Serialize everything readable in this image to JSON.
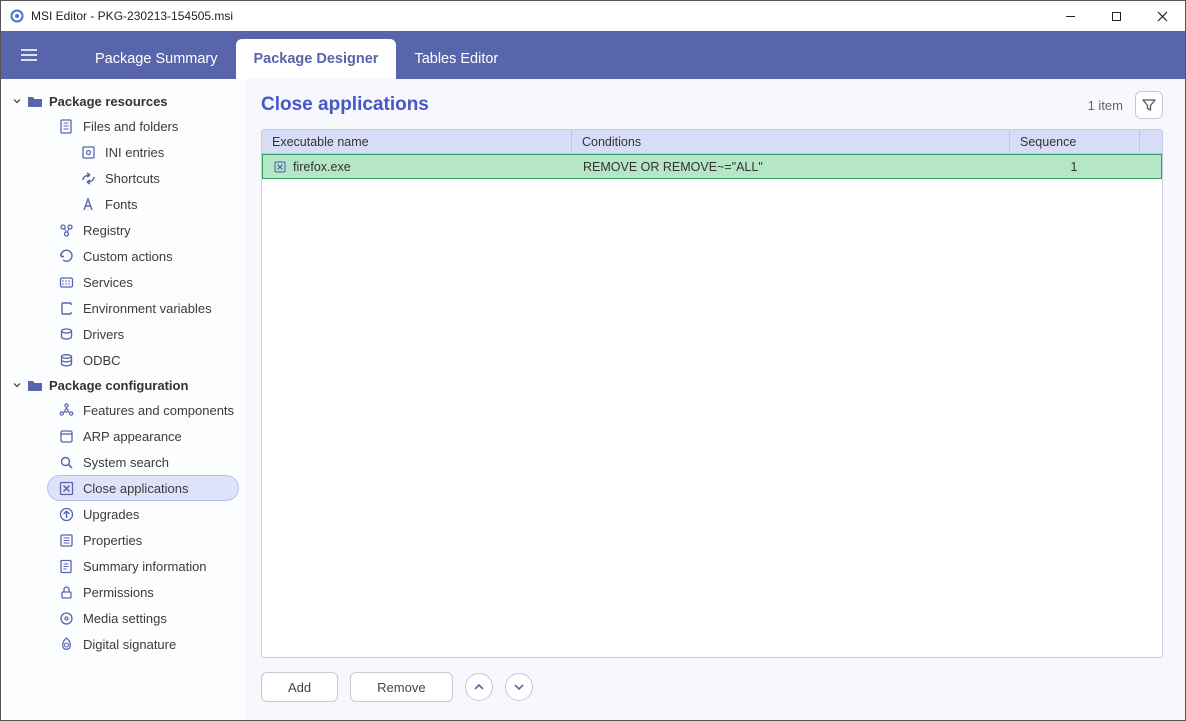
{
  "window": {
    "title": "MSI Editor - PKG-230213-154505.msi"
  },
  "nav": {
    "items": [
      {
        "label": "Package Summary",
        "active": false
      },
      {
        "label": "Package Designer",
        "active": true
      },
      {
        "label": "Tables Editor",
        "active": false
      }
    ]
  },
  "sidebar": {
    "groups": [
      {
        "label": "Package resources",
        "items": [
          {
            "label": "Files and folders",
            "icon": "file-icon",
            "depth": 1
          },
          {
            "label": "INI entries",
            "icon": "ini-icon",
            "depth": 2
          },
          {
            "label": "Shortcuts",
            "icon": "shortcut-icon",
            "depth": 2
          },
          {
            "label": "Fonts",
            "icon": "font-icon",
            "depth": 2
          },
          {
            "label": "Registry",
            "icon": "registry-icon",
            "depth": 1
          },
          {
            "label": "Custom actions",
            "icon": "action-icon",
            "depth": 1
          },
          {
            "label": "Services",
            "icon": "services-icon",
            "depth": 1
          },
          {
            "label": "Environment variables",
            "icon": "env-icon",
            "depth": 1
          },
          {
            "label": "Drivers",
            "icon": "drivers-icon",
            "depth": 1
          },
          {
            "label": "ODBC",
            "icon": "odbc-icon",
            "depth": 1
          }
        ]
      },
      {
        "label": "Package configuration",
        "items": [
          {
            "label": "Features and components",
            "icon": "features-icon",
            "depth": 1
          },
          {
            "label": "ARP appearance",
            "icon": "arp-icon",
            "depth": 1
          },
          {
            "label": "System search",
            "icon": "search-icon",
            "depth": 1
          },
          {
            "label": "Close applications",
            "icon": "close-app-icon",
            "depth": 1,
            "selected": true
          },
          {
            "label": "Upgrades",
            "icon": "upgrades-icon",
            "depth": 1
          },
          {
            "label": "Properties",
            "icon": "properties-icon",
            "depth": 1
          },
          {
            "label": "Summary information",
            "icon": "summary-icon",
            "depth": 1
          },
          {
            "label": "Permissions",
            "icon": "permissions-icon",
            "depth": 1
          },
          {
            "label": "Media settings",
            "icon": "media-icon",
            "depth": 1
          },
          {
            "label": "Digital signature",
            "icon": "signature-icon",
            "depth": 1
          }
        ]
      }
    ]
  },
  "page": {
    "title": "Close applications",
    "count_label": "1 item"
  },
  "table": {
    "headers": {
      "exec": "Executable name",
      "cond": "Conditions",
      "seq": "Sequence"
    },
    "rows": [
      {
        "exec": "firefox.exe",
        "cond": "REMOVE OR REMOVE~=\"ALL\"",
        "seq": "1",
        "selected": true
      }
    ]
  },
  "footer": {
    "add": "Add",
    "remove": "Remove"
  },
  "icons": {
    "file-icon": "<rect x='3' y='2' width='10' height='13' rx='1' fill='none' stroke='currentColor' stroke-width='1.3'/><line x1='5.5' y1='5' x2='10.5' y2='5' stroke='currentColor'/><line x1='5.5' y1='8' x2='10.5' y2='8' stroke='currentColor'/><line x1='5.5' y1='11' x2='10.5' y2='11' stroke='currentColor'/>",
    "ini-icon": "<rect x='3' y='3' width='11' height='11' rx='1' fill='none' stroke='currentColor' stroke-width='1.3'/><circle cx='8.5' cy='8.5' r='2' fill='none' stroke='currentColor' stroke-width='1.2'/>",
    "shortcut-icon": "<path d='M3 10 C 3 5, 10 5, 10 5 M10 5 L7 3 M10 5 L7 7' fill='none' stroke='currentColor' stroke-width='1.4'/><path d='M14 7 C 14 12, 7 12, 7 12 M7 12 L10 14 M7 12 L10 10' fill='none' stroke='currentColor' stroke-width='1.4'/>",
    "font-icon": "<path d='M4 14 L8 3 L12 14 M5.5 10 H10.5' fill='none' stroke='currentColor' stroke-width='1.4'/>",
    "registry-icon": "<circle cx='5' cy='5' r='2' fill='none' stroke='currentColor' stroke-width='1.3'/><circle cx='12' cy='5' r='2' fill='none' stroke='currentColor' stroke-width='1.3'/><circle cx='8.5' cy='12' r='2' fill='none' stroke='currentColor' stroke-width='1.3'/><line x1='6.5' y1='6.5' x2='8' y2='10' stroke='currentColor'/><line x1='11' y1='6.5' x2='9.5' y2='10' stroke='currentColor'/>",
    "action-icon": "<path d='M3 8.5 A5.5 5.5 0 1 1 5 12' fill='none' stroke='currentColor' stroke-width='1.4'/><path d='M3 8.5 L3 5 M3 8.5 L6 8.5' fill='none' stroke='currentColor' stroke-width='1.4'/>",
    "services-icon": "<rect x='2.5' y='4' width='12' height='9' rx='1.5' fill='none' stroke='currentColor' stroke-width='1.3'/><circle cx='5' cy='7' r='0.8' fill='currentColor'/><circle cx='8' cy='7' r='0.8' fill='currentColor'/><circle cx='11' cy='7' r='0.8' fill='currentColor'/><circle cx='5' cy='10' r='0.8' fill='currentColor'/><circle cx='8' cy='10' r='0.8' fill='currentColor'/><circle cx='11' cy='10' r='0.8' fill='currentColor'/>",
    "env-icon": "<path d='M4 3 L4 14 M4 3 L13 3 M4 14 L13 14 M13 3 L13 5 M13 14 L13 12' fill='none' stroke='currentColor' stroke-width='1.4'/>",
    "drivers-icon": "<ellipse cx='8.5' cy='5' rx='5' ry='2' fill='none' stroke='currentColor' stroke-width='1.3'/><path d='M3.5 5 V11 A5 2 0 0 0 13.5 11 V5' fill='none' stroke='currentColor' stroke-width='1.3'/>",
    "odbc-icon": "<ellipse cx='8.5' cy='4.5' rx='5' ry='1.8' fill='none' stroke='currentColor' stroke-width='1.3'/><path d='M3.5 4.5 V12 A5 1.8 0 0 0 13.5 12 V4.5' fill='none' stroke='currentColor' stroke-width='1.3'/><path d='M3.5 8 A5 1.8 0 0 0 13.5 8' fill='none' stroke='currentColor' stroke-width='1.3'/>",
    "features-icon": "<circle cx='8.5' cy='8.5' r='1.6' fill='none' stroke='currentColor' stroke-width='1.2'/><circle cx='8.5' cy='3.5' r='1.6' fill='none' stroke='currentColor' stroke-width='1.2'/><circle cx='3.8' cy='11.5' r='1.6' fill='none' stroke='currentColor' stroke-width='1.2'/><circle cx='13.2' cy='11.5' r='1.6' fill='none' stroke='currentColor' stroke-width='1.2'/><line x1='8.5' y1='5' x2='8.5' y2='7' stroke='currentColor'/><line x1='7.3' y1='9.5' x2='5' y2='10.7' stroke='currentColor'/><line x1='9.7' y1='9.5' x2='12' y2='10.7' stroke='currentColor'/>",
    "arp-icon": "<rect x='3' y='3' width='11' height='11' rx='1.5' fill='none' stroke='currentColor' stroke-width='1.3'/><line x1='3' y1='6' x2='14' y2='6' stroke='currentColor' stroke-width='1.3'/>",
    "search-icon": "<circle cx='7.5' cy='7.5' r='4' fill='none' stroke='currentColor' stroke-width='1.4'/><line x1='10.5' y1='10.5' x2='14' y2='14' stroke='currentColor' stroke-width='1.6'/>",
    "close-app-icon": "<rect x='2.5' y='2.5' width='12' height='12' rx='1' fill='none' stroke='currentColor' stroke-width='1.3'/><line x1='5.5' y1='5.5' x2='11.5' y2='11.5' stroke='currentColor' stroke-width='1.5'/><line x1='11.5' y1='5.5' x2='5.5' y2='11.5' stroke='currentColor' stroke-width='1.5'/>",
    "upgrades-icon": "<circle cx='8.5' cy='8.5' r='6' fill='none' stroke='currentColor' stroke-width='1.3'/><path d='M8.5 12 V5 M8.5 5 L5.5 8 M8.5 5 L11.5 8' fill='none' stroke='currentColor' stroke-width='1.4'/>",
    "properties-icon": "<rect x='3' y='3' width='11' height='11' rx='1' fill='none' stroke='currentColor' stroke-width='1.3'/><line x1='5.5' y1='6' x2='11.5' y2='6' stroke='currentColor'/><line x1='5.5' y1='8.5' x2='11.5' y2='8.5' stroke='currentColor'/><line x1='5.5' y1='11' x2='11.5' y2='11' stroke='currentColor'/>",
    "summary-icon": "<rect x='3' y='2.5' width='10' height='12' rx='1' fill='none' stroke='currentColor' stroke-width='1.3'/><line x1='5.5' y1='6' x2='10.5' y2='6' stroke='currentColor'/><line x1='5.5' y1='8.5' x2='10.5' y2='8.5' stroke='currentColor'/><line x1='5.5' y1='11' x2='8.5' y2='11' stroke='currentColor'/>",
    "permissions-icon": "<rect x='4' y='8' width='9' height='6' rx='1' fill='none' stroke='currentColor' stroke-width='1.3'/><path d='M6 8 V5.5 A2.5 2.5 0 0 1 11 5.5 V8' fill='none' stroke='currentColor' stroke-width='1.3'/>",
    "media-icon": "<circle cx='8.5' cy='8.5' r='5.5' fill='none' stroke='currentColor' stroke-width='1.3'/><circle cx='8.5' cy='8.5' r='1.5' fill='none' stroke='currentColor' stroke-width='1.2'/>",
    "signature-icon": "<path d='M8.5 2 C5 5 4 8 5 11 C6 14 11 14 12 11 C13 8 12 5 8.5 2 Z' fill='none' stroke='currentColor' stroke-width='1.2'/><circle cx='8.5' cy='9' r='2' fill='none' stroke='currentColor' stroke-width='1.1'/>"
  }
}
